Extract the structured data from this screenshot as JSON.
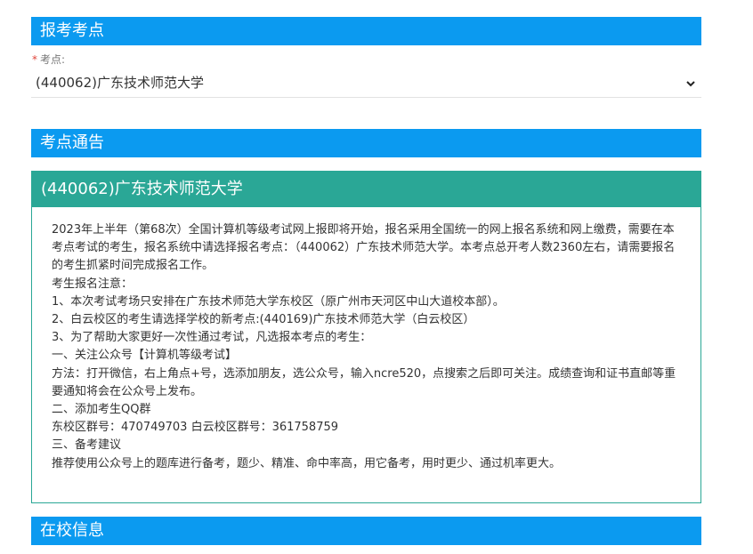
{
  "sections": {
    "exam_site": "报考考点",
    "site_notice": "考点通告",
    "school_info": "在校信息"
  },
  "exam_site_field": {
    "required_mark": "*",
    "label": "考点:",
    "selected": "(440062)广东技术师范大学",
    "chevron_icon": "chevron-down-icon"
  },
  "notice": {
    "title": "(440062)广东技术师范大学",
    "lines": [
      "2023年上半年（第68次）全国计算机等级考试网上报即将开始，报名采用全国统一的网上报名系统和网上缴费，需要在本考点考试的考生，报名系统中请选择报名考点：（440062）广东技术师范大学。本考点总开考人数2360左右，请需要报名的考生抓紧时间完成报名工作。",
      "考生报名注意：",
      "1、本次考试考场只安排在广东技术师范大学东校区（原广州市天河区中山大道校本部）。",
      "2、白云校区的考生请选择学校的新考点:(440169)广东技术师范大学（白云校区）",
      "3、为了帮助大家更好一次性通过考试，凡选报本考点的考生：",
      "一、关注公众号【计算机等级考试】",
      "方法：打开微信，右上角点+号，选添加朋友，选公众号，输入ncre520，点搜索之后即可关注。成绩查询和证书直邮等重要通知将会在公众号上发布。",
      "二、添加考生QQ群",
      "东校区群号：470749703 白云校区群号：361758759",
      "三、备考建议",
      "推荐使用公众号上的题库进行备考，题少、精准、命中率高，用它备考，用时更少、通过机率更大。"
    ]
  },
  "colors": {
    "section_bar": "#0b9af0",
    "notice_teal": "#2aa796",
    "required": "#e0453a"
  }
}
